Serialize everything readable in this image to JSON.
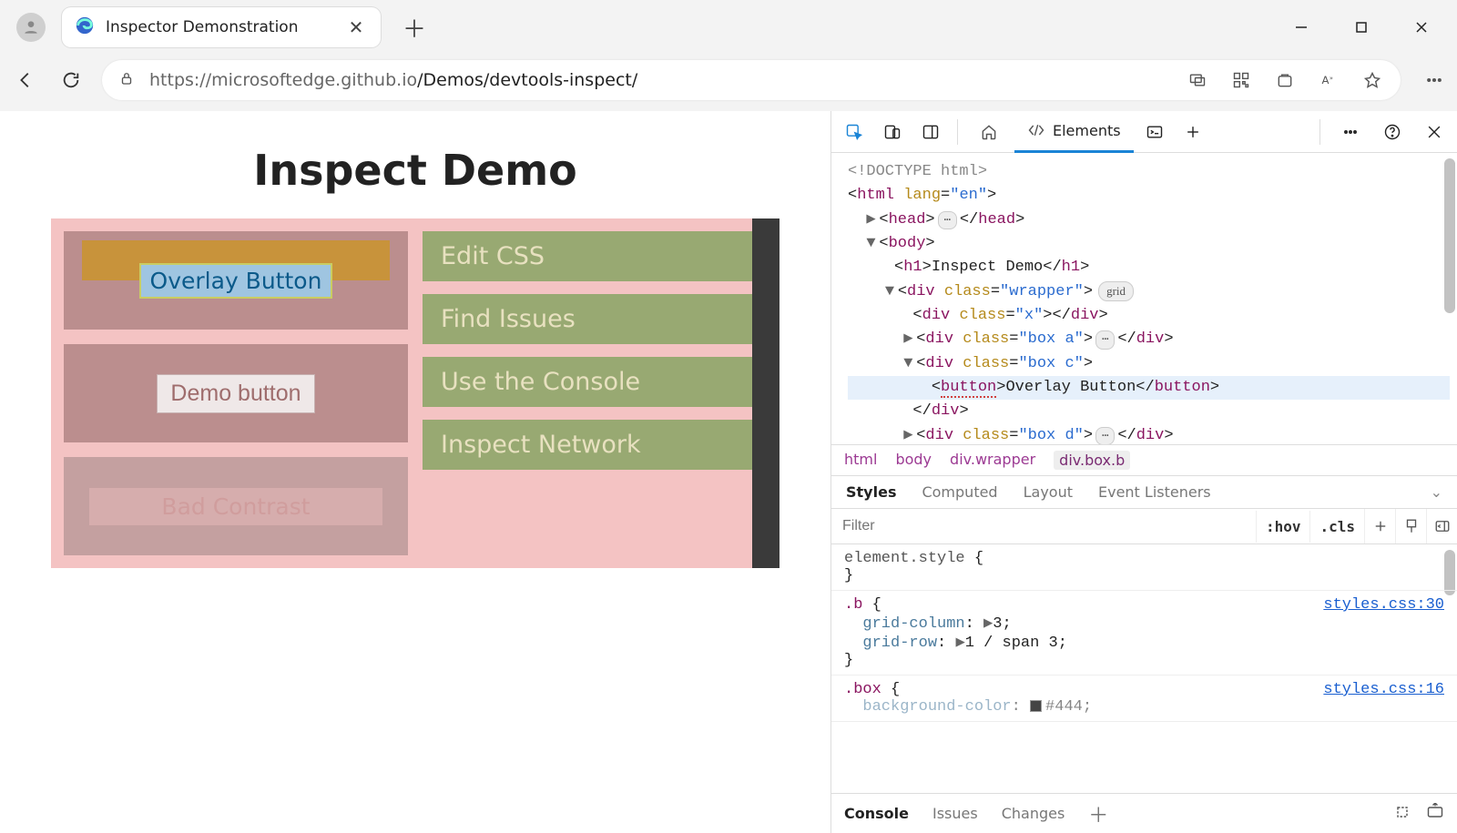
{
  "browser": {
    "tab_title": "Inspector Demonstration",
    "url_host": "https://microsoftedge.github.io",
    "url_path": "/Demos/devtools-inspect/"
  },
  "page": {
    "heading": "Inspect Demo",
    "overlay_button": "Overlay Button",
    "demo_button": "Demo button",
    "bad_contrast": "Bad Contrast",
    "green_links": [
      "Edit CSS",
      "Find Issues",
      "Use the Console",
      "Inspect Network"
    ]
  },
  "devtools": {
    "elements_tab": "Elements",
    "dom": {
      "doctype": "<!DOCTYPE html>",
      "html_open": "html",
      "html_lang": "en",
      "head": "head",
      "body": "body",
      "h1_text": "Inspect Demo",
      "wrapper_class": "wrapper",
      "grid_badge": "grid",
      "x_class": "x",
      "box_a_class": "box a",
      "box_c_class": "box c",
      "button_text": "Overlay Button",
      "box_d_class": "box d"
    },
    "breadcrumb": [
      "html",
      "body",
      "div.wrapper",
      "div.box.b"
    ],
    "styles_tabs": [
      "Styles",
      "Computed",
      "Layout",
      "Event Listeners"
    ],
    "filter_placeholder": "Filter",
    "hov": ":hov",
    "cls": ".cls",
    "rules": {
      "element_style": "element.style",
      "b_selector": ".b",
      "b_src": "styles.css:30",
      "b_props": [
        {
          "prop": "grid-column",
          "val": "3"
        },
        {
          "prop": "grid-row",
          "val": "1 / span 3"
        }
      ],
      "box_selector": ".box",
      "box_src": "styles.css:16",
      "box_prop": "background-color",
      "box_val": "#444"
    },
    "drawer_tabs": [
      "Console",
      "Issues",
      "Changes"
    ]
  }
}
